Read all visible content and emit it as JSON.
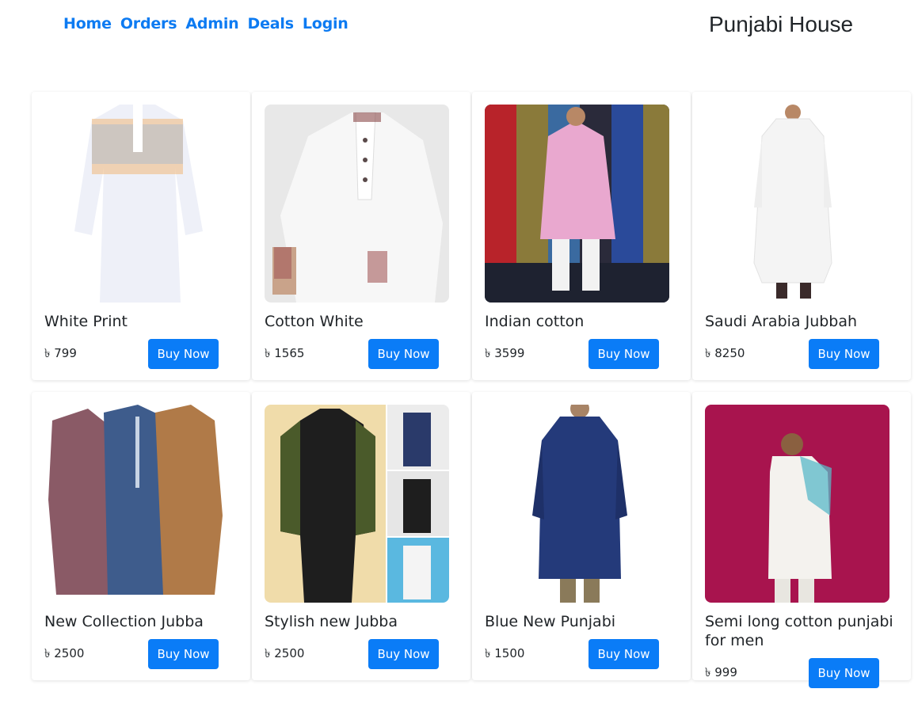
{
  "nav": {
    "links": [
      "Home",
      "Orders",
      "Admin",
      "Deals",
      "Login"
    ],
    "brand": "Punjabi House"
  },
  "colors": {
    "link": "#0d7bf2",
    "button": "#0a7cf7",
    "text": "#212529"
  },
  "products": [
    {
      "title": "White Print",
      "price": "৳ 799",
      "button": "Buy Now",
      "image": "white-print-punjabi-image"
    },
    {
      "title": "Cotton White",
      "price": "৳ 1565",
      "button": "Buy Now",
      "image": "cotton-white-punjabi-image"
    },
    {
      "title": "Indian cotton",
      "price": "৳ 3599",
      "button": "Buy Now",
      "image": "indian-cotton-punjabi-image"
    },
    {
      "title": "Saudi Arabia Jubbah",
      "price": "৳ 8250",
      "button": "Buy Now",
      "image": "saudi-arabia-jubbah-image"
    },
    {
      "title": "New Collection Jubba",
      "price": "৳ 2500",
      "button": "Buy Now",
      "image": "new-collection-jubba-image"
    },
    {
      "title": "Stylish new Jubba",
      "price": "৳ 2500",
      "button": "Buy Now",
      "image": "stylish-new-jubba-image"
    },
    {
      "title": "Blue New Punjabi",
      "price": "৳ 1500",
      "button": "Buy Now",
      "image": "blue-new-punjabi-image"
    },
    {
      "title": "Semi long cotton punjabi for men",
      "price": "৳ 999",
      "button": "Buy Now",
      "image": "semi-long-cotton-punjabi-image"
    }
  ]
}
